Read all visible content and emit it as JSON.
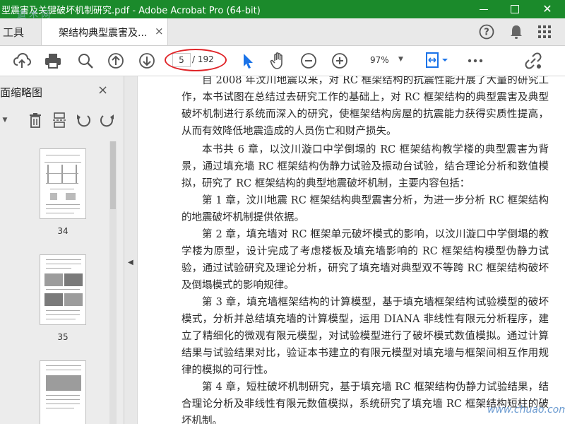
{
  "window": {
    "title": "型震害及关键破坏机制研究.pdf - Adobe Acrobat Pro (64-bit)"
  },
  "tabs": {
    "tools_label": "工具",
    "doc_tab_label": "架结构典型震害及...",
    "doc_tab_close": "×"
  },
  "header_icons": {
    "help": "help-icon",
    "notifications": "bell-icon",
    "apps": "apps-grid-icon"
  },
  "toolbar": {
    "current_page": "5",
    "total_pages": "/ 192",
    "zoom": "97%",
    "icons": [
      "cloud-upload-icon",
      "print-icon",
      "zoom-search-icon",
      "page-up-icon",
      "page-down-icon",
      "select-pointer-icon",
      "hand-tool-icon",
      "zoom-out-icon",
      "zoom-in-icon",
      "fit-page-icon",
      "more-icon",
      "share-link-icon"
    ]
  },
  "side_panel": {
    "title": "面缩略图",
    "close": "×",
    "thumbnails": [
      {
        "label": "34"
      },
      {
        "label": "35"
      }
    ]
  },
  "document": {
    "paragraphs": [
      "自 2008 年汶川地震以来，对 RC 框架结构的抗震性能开展了大量的研究工作，本书试图在总结过去研究工作的基础上，对 RC 框架结构的典型震害及典型破坏机制进行系统而深入的研究，使框架结构房屋的抗震能力获得实质性提高，从而有效降低地震造成的人员伤亡和财产损失。",
      "本书共 6 章，以汶川漩口中学倒塌的 RC 框架结构教学楼的典型震害为背景，通过填充墙 RC 框架结构伪静力试验及振动台试验，结合理论分析和数值模拟，研究了 RC 框架结构的典型地震破坏机制，主要内容包括：",
      "第 1 章，汶川地震 RC 框架结构典型震害分析，为进一步分析 RC 框架结构的地震破坏机制提供依据。",
      "第 2 章，填充墙对 RC 框架单元破坏模式的影响，以汶川漩口中学倒塌的教学楼为原型，设计完成了考虑楼板及填充墙影响的 RC 框架结构模型伪静力试验，通过试验研究及理论分析，研究了填充墙对典型双不等跨 RC 框架结构破坏及倒塌模式的影响规律。",
      "第 3 章，填充墙框架结构的计算模型，基于填充墙框架结构试验模型的破坏模式，分析并总结填充墙的计算模型，运用 DIANA 非线性有限元分析程序，建立了精细化的微观有限元模型，对试验模型进行了破坏模式数值模拟。通过计算结果与试验结果对比，验证本书建立的有限元模型对填充墙与框架间相互作用规律的模拟的可行性。",
      "第 4 章，短柱破坏机制研究，基于填充墙 RC 框架结构伪静力试验结果，结合理论分析及非线性有限元数值模拟，系统研究了填充墙 RC 框架结构短柱的破坏机制。"
    ]
  },
  "overlay": {
    "watermark": "道 术 网",
    "logo": "www.chuao.com"
  },
  "colors": {
    "titlebar": "#1b8a2b",
    "highlight": "#e0262a",
    "frame": "#ffff00",
    "pointer_active": "#1a73e8"
  }
}
